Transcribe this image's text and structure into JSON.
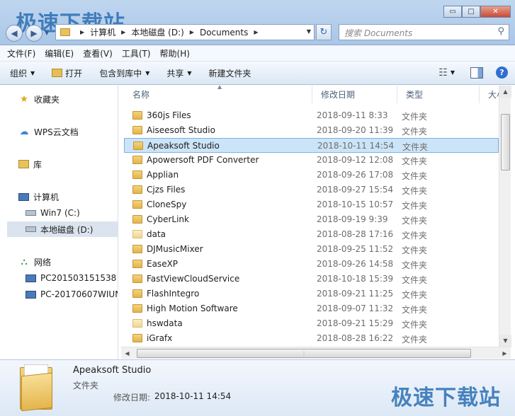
{
  "watermark": "极速下载站",
  "window_buttons": {
    "minimize": "▭",
    "maximize": "□",
    "close": "✕"
  },
  "nav": {
    "back": "◀",
    "forward": "▶"
  },
  "address": {
    "crumbs": [
      "计算机",
      "本地磁盘 (D:)",
      "Documents"
    ],
    "sep": "▶",
    "dropdown": "▼",
    "refresh": "↻"
  },
  "search": {
    "placeholder": "搜索 Documents",
    "icon": "search-icon"
  },
  "menu": [
    "文件(F)",
    "编辑(E)",
    "查看(V)",
    "工具(T)",
    "帮助(H)"
  ],
  "toolbar": {
    "organize": "组织",
    "open": "打开",
    "include_library": "包含到库中",
    "share": "共享",
    "new_folder": "新建文件夹",
    "caret": "▼",
    "help": "?"
  },
  "sidebar": {
    "favorites": "收藏夹",
    "wps_cloud": "WPS云文档",
    "library": "库",
    "computer": "计算机",
    "drive_c": "Win7 (C:)",
    "drive_d": "本地磁盘 (D:)",
    "network": "网络",
    "pc1": "PC201503151538",
    "pc2": "PC-20170607WIUN"
  },
  "columns": {
    "name": "名称",
    "date": "修改日期",
    "type": "类型",
    "size": "大小"
  },
  "files": [
    {
      "name": "360js Files",
      "date": "2018-09-11 8:33",
      "type": "文件夹"
    },
    {
      "name": "Aiseesoft Studio",
      "date": "2018-09-20 11:39",
      "type": "文件夹"
    },
    {
      "name": "Apeaksoft Studio",
      "date": "2018-10-11 14:54",
      "type": "文件夹"
    },
    {
      "name": "Apowersoft PDF Converter",
      "date": "2018-09-12 12:08",
      "type": "文件夹"
    },
    {
      "name": "Applian",
      "date": "2018-09-26 17:08",
      "type": "文件夹"
    },
    {
      "name": "Cjzs Files",
      "date": "2018-09-27 15:54",
      "type": "文件夹"
    },
    {
      "name": "CloneSpy",
      "date": "2018-10-15 10:57",
      "type": "文件夹"
    },
    {
      "name": "CyberLink",
      "date": "2018-09-19 9:39",
      "type": "文件夹"
    },
    {
      "name": "data",
      "date": "2018-08-28 17:16",
      "type": "文件夹"
    },
    {
      "name": "DJMusicMixer",
      "date": "2018-09-25 11:52",
      "type": "文件夹"
    },
    {
      "name": "EaseXP",
      "date": "2018-09-26 14:58",
      "type": "文件夹"
    },
    {
      "name": "FastViewCloudService",
      "date": "2018-10-18 15:39",
      "type": "文件夹"
    },
    {
      "name": "FlashIntegro",
      "date": "2018-09-21 11:25",
      "type": "文件夹"
    },
    {
      "name": "High Motion Software",
      "date": "2018-09-07 11:32",
      "type": "文件夹"
    },
    {
      "name": "hswdata",
      "date": "2018-09-21 15:29",
      "type": "文件夹"
    },
    {
      "name": "iGrafx",
      "date": "2018-08-28 16:22",
      "type": "文件夹"
    }
  ],
  "details": {
    "name": "Apeaksoft Studio",
    "type": "文件夹",
    "modified_label": "修改日期:",
    "modified_value": "2018-10-11 14:54"
  }
}
